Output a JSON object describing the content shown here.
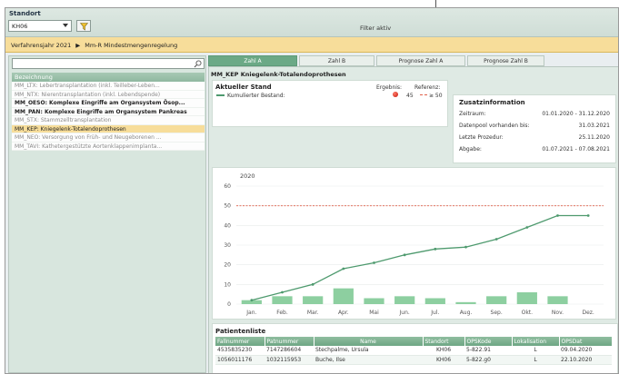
{
  "header": {
    "standort_label": "Standort",
    "standort_value": "KH06",
    "filter_status": "Filter aktiv"
  },
  "breadcrumb": {
    "year": "Verfahrensjahr 2021",
    "separator": "▶",
    "section": "Mm-R Mindestmengenregelung"
  },
  "sidebar": {
    "search_placeholder": "",
    "column_header": "Bezeichnung",
    "items": [
      {
        "label": "MM_LTX: Lebertransplantation (inkl. Teilleber-Leben...",
        "state": "inactive"
      },
      {
        "label": "MM_NTX: Nierentransplantation (inkl. Lebendspende)",
        "state": "inactive"
      },
      {
        "label": "MM_OESO: Komplexe Eingriffe am Organsystem Ösop...",
        "state": "active"
      },
      {
        "label": "MM_PAN: Komplexe Eingriffe am Organsystem Pankreas",
        "state": "active"
      },
      {
        "label": "MM_STX: Stammzelltransplantation",
        "state": "inactive"
      },
      {
        "label": "MM_KEP: Kniegelenk-Totalendoprothesen",
        "state": "selected"
      },
      {
        "label": "MM_NEO: Versorgung von Früh- und Neugeborenen ...",
        "state": "inactive"
      },
      {
        "label": "MM_TAVI: Kathetergestützte Aortenklappenimplanta...",
        "state": "inactive"
      }
    ]
  },
  "tabs": [
    {
      "label": "Zahl A",
      "active": true
    },
    {
      "label": "Zahl B",
      "active": false
    },
    {
      "label": "Prognose Zahl A",
      "active": false
    },
    {
      "label": "Prognose Zahl B",
      "active": false
    }
  ],
  "main": {
    "title": "MM_KEP Kniegelenk-Totalendoprothesen"
  },
  "stand": {
    "title": "Aktueller Stand",
    "col_result": "Ergebnis:",
    "col_reference": "Referenz:",
    "legend": "Kumulierter Bestand:",
    "result_value": "45",
    "reference_value": "≥ 50",
    "result_color": "#d0200f",
    "series_color": "#4e9a6e"
  },
  "info": {
    "title": "Zusatzinformation",
    "rows": [
      {
        "label": "Zeitraum:",
        "value": "01.01.2020 - 31.12.2020"
      },
      {
        "label": "Datenpool vorhanden bis:",
        "value": "31.03.2021"
      },
      {
        "label": "Letzte Prozedur:",
        "value": "25.11.2020"
      },
      {
        "label": "Abgabe:",
        "value": "01.07.2021 - 07.08.2021"
      }
    ]
  },
  "chart_data": {
    "type": "bar",
    "title": "2020",
    "categories": [
      "Jan.",
      "Feb.",
      "Mar.",
      "Apr.",
      "Mai",
      "Jun.",
      "Jul.",
      "Aug.",
      "Sep.",
      "Okt.",
      "Nov.",
      "Dez."
    ],
    "series": [
      {
        "type": "bar",
        "values": [
          2,
          4,
          4,
          8,
          3,
          4,
          3,
          1,
          4,
          6,
          4,
          0
        ]
      },
      {
        "type": "line",
        "values": [
          2,
          6,
          10,
          18,
          21,
          25,
          28,
          29,
          33,
          39,
          45,
          45
        ]
      }
    ],
    "reference_line": 50,
    "ylim": [
      0,
      60
    ],
    "yticks": [
      0,
      10,
      20,
      30,
      40,
      50,
      60
    ],
    "bar_color": "#8dcfa0",
    "line_color": "#4e9a6e",
    "reference_color": "#e0604a"
  },
  "table": {
    "title": "Patientenliste",
    "columns": [
      "Fallnummer",
      "Patnummer",
      "Name",
      "Standort",
      "OPSKode",
      "Lokalisation",
      "OPSDat"
    ],
    "rows": [
      [
        "4535835230",
        "7147286604",
        "Stechpalme, Ursula",
        "KH06",
        "5-822.91",
        "L",
        "09.04.2020"
      ],
      [
        "1056011176",
        "1032115953",
        "Buche, Ilse",
        "KH06",
        "5-822.g0",
        "L",
        "22.10.2020"
      ]
    ]
  }
}
